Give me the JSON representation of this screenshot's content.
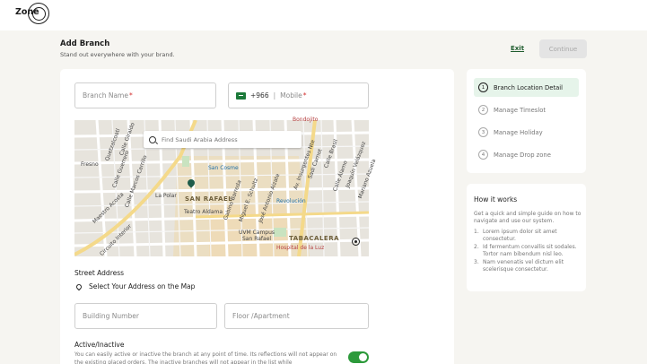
{
  "app": {
    "logo_text": "Zone"
  },
  "header": {
    "title": "Add Branch",
    "subtitle": "Stand out everywhere with your brand.",
    "exit_label": "Exit",
    "continue_label": "Continue"
  },
  "form": {
    "branch_name_placeholder": "Branch Name",
    "required_mark": "*",
    "country_code": "+966",
    "separator": "|",
    "mobile_placeholder": "Mobile",
    "map_search_placeholder": "Find Saudi Arabia Address",
    "street_address_label": "Street Address",
    "select_address_label": "Select Your Address on the Map",
    "building_number_placeholder": "Building Number",
    "floor_placeholder": "Floor /Apartment",
    "active_label": "Active/Inactive",
    "active_description": "You can easily active or inactive the branch at any point of time. Its reflections will not appear on the existing placed orders. The inactive branches will not appear in the list while",
    "active_state": true
  },
  "map": {
    "labels": {
      "san_rafael": "SAN RAFAEL",
      "tabacalera": "TABACALERA",
      "san_cosme": "San Cosme",
      "la_polar": "La Polar",
      "teatro_aldama": "Teatro Aldama",
      "uvm_campus": "UVM Campus",
      "uvm_campus_2": "San Rafael",
      "hospital": "Hospital de la Luz",
      "revolucion": "Revolución",
      "insurgentes": "Av. Insurgentes Nte",
      "bondojito": "Bondojito",
      "calle_alamo": "Calle Álamo",
      "marcos_carrillo": "Calle Marcos Carrillo",
      "calle_brasil": "Calle Brasil",
      "calle_guerrero": "Calle Guerrero",
      "calle_giraldo": "Calle Giraldo",
      "quetzalcoatl": "Quetzalcoatl",
      "fresno": "Fresno",
      "circuito": "Circuito Interior",
      "maestro": "Maestro Acosta",
      "miguel": "Miguel E. Schultz",
      "jose": "José Antonio Alzate",
      "gabino": "Gabino Barreda",
      "sadi": "Sadi Carnot",
      "joaquin": "Joaquín Velázquez",
      "mariano": "Mariano Azuela"
    }
  },
  "steps": [
    {
      "num": "1",
      "label": "Branch Location Detail",
      "active": true
    },
    {
      "num": "2",
      "label": "Manage Timeslot",
      "active": false
    },
    {
      "num": "3",
      "label": "Manage Holiday",
      "active": false
    },
    {
      "num": "4",
      "label": "Manage Drop zone",
      "active": false
    }
  ],
  "how_it_works": {
    "title": "How it works",
    "description": "Get a quick and simple guide on how to navigate and use our system.",
    "items": [
      {
        "num": "1.",
        "text": "Lorem ipsum dolor sit amet consectetur."
      },
      {
        "num": "2.",
        "text": "Id fermentum convallis sit sodales. Tortor nam bibendum nisl leo."
      },
      {
        "num": "3.",
        "text": "Nam venenatis vel dictum elit scelerisque consectetur."
      }
    ]
  },
  "colors": {
    "accent": "#1f5c2e",
    "toggle_on": "#2d9a3b",
    "required": "#d32f2f",
    "step_active_bg": "#e6f4ea"
  }
}
